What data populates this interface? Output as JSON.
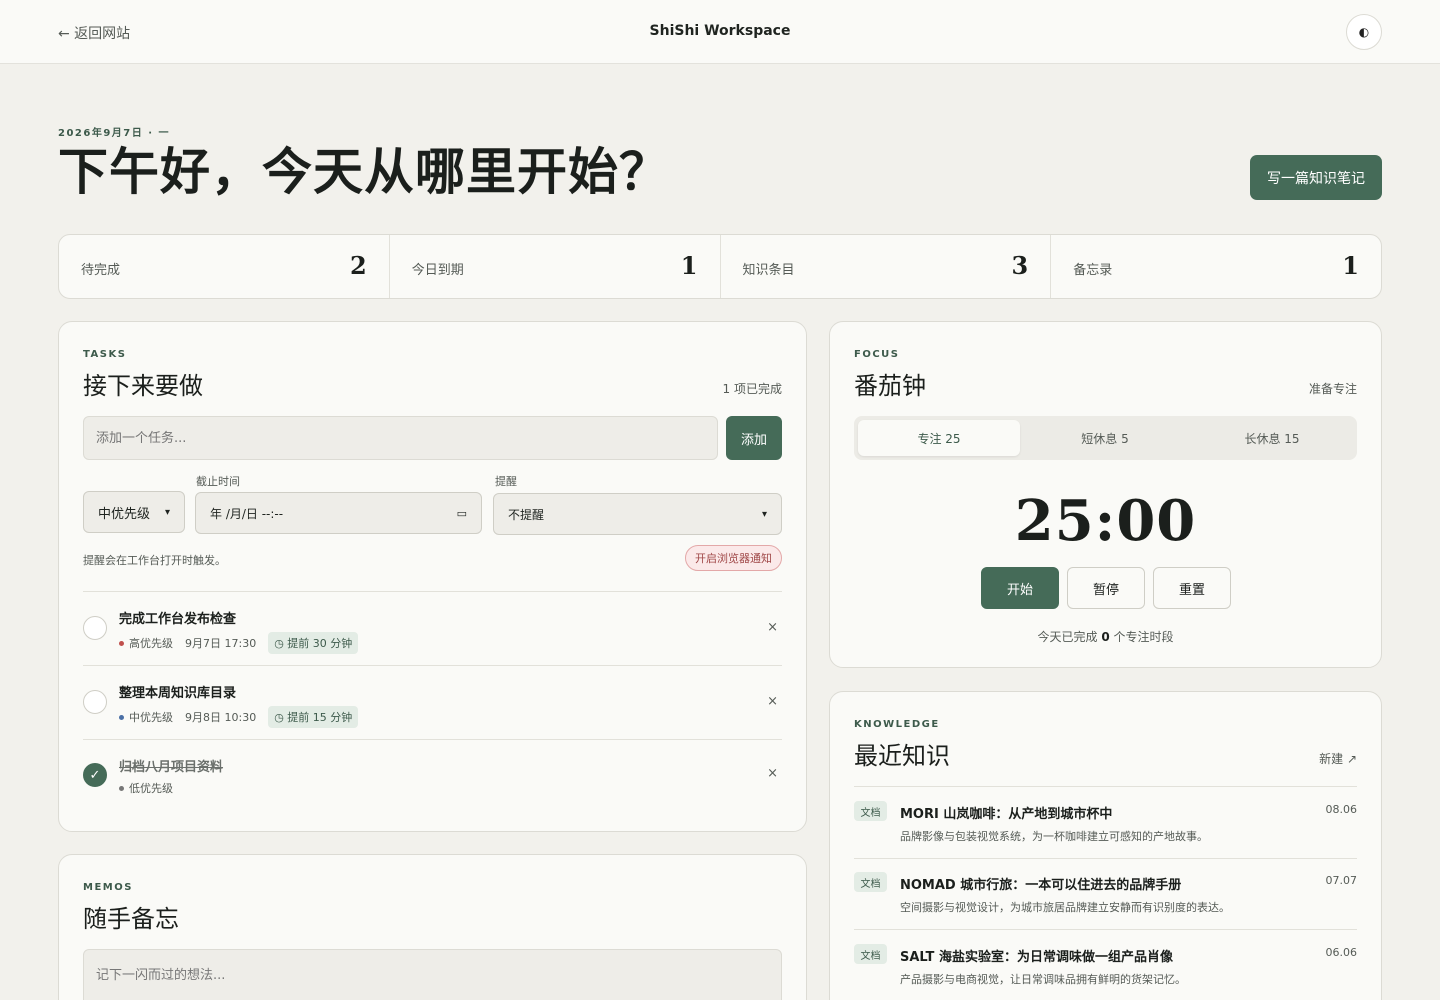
{
  "topbar": {
    "back_label": "← 返回网站",
    "title": "ShiShi Workspace",
    "theme_icon": "◐"
  },
  "header": {
    "date": "2026年9月7日 · 一",
    "greeting": "下午好，今天从哪里开始？",
    "write_button": "写一篇知识笔记"
  },
  "stats": [
    {
      "label": "待完成",
      "value": "2"
    },
    {
      "label": "今日到期",
      "value": "1"
    },
    {
      "label": "知识条目",
      "value": "3"
    },
    {
      "label": "备忘录",
      "value": "1"
    }
  ],
  "tasks": {
    "eyebrow": "TASKS",
    "title": "接下来要做",
    "completed_info": "1 项已完成",
    "input_placeholder": "添加一个任务...",
    "add_button": "添加",
    "priority_value": "中优先级",
    "deadline_label": "截止时间",
    "deadline_placeholder": "年 /月/日 --:--",
    "reminder_label": "提醒",
    "reminder_value": "不提醒",
    "hint": "提醒会在工作台打开时触发。",
    "notify_button": "开启浏览器通知",
    "items": [
      {
        "title": "完成工作台发布检查",
        "priority": "高优先级",
        "priority_color": "#c0504d",
        "time": "9月7日 17:30",
        "remind": "◷ 提前 30 分钟",
        "done": false
      },
      {
        "title": "整理本周知识库目录",
        "priority": "中优先级",
        "priority_color": "#4a6fa5",
        "time": "9月8日 10:30",
        "remind": "◷ 提前 15 分钟",
        "done": false
      },
      {
        "title": "归档八月项目资料",
        "priority": "低优先级",
        "priority_color": "#777777",
        "time": "",
        "remind": "",
        "done": true
      }
    ],
    "delete_glyph": "×",
    "check_glyph": "✓"
  },
  "focus": {
    "eyebrow": "FOCUS",
    "title": "番茄钟",
    "status": "准备专注",
    "modes": [
      "专注 25",
      "短休息 5",
      "长休息 15"
    ],
    "timer": "25:00",
    "start": "开始",
    "pause": "暂停",
    "reset": "重置",
    "count_prefix": "今天已完成",
    "count": "0",
    "count_suffix": "个专注时段"
  },
  "knowledge": {
    "eyebrow": "KNOWLEDGE",
    "title": "最近知识",
    "new_link": "新建 ↗",
    "items": [
      {
        "tag": "文档",
        "title": "MORI 山岚咖啡：从产地到城市杯中",
        "desc": "品牌影像与包装视觉系统，为一杯咖啡建立可感知的产地故事。",
        "date": "08.06"
      },
      {
        "tag": "文档",
        "title": "NOMAD 城市行旅：一本可以住进去的品牌手册",
        "desc": "空间摄影与视觉设计，为城市旅居品牌建立安静而有识别度的表达。",
        "date": "07.07"
      },
      {
        "tag": "文档",
        "title": "SALT 海盐实验室：为日常调味做一组产品肖像",
        "desc": "产品摄影与电商视觉，让日常调味品拥有鲜明的货架记忆。",
        "date": "06.06"
      }
    ]
  },
  "memos": {
    "eyebrow": "MEMOS",
    "title": "随手备忘",
    "placeholder": "记下一闪而过的想法..."
  },
  "colors": {
    "accent": "#456b58",
    "background": "#f2f1ec",
    "card": "#fafaf7"
  }
}
